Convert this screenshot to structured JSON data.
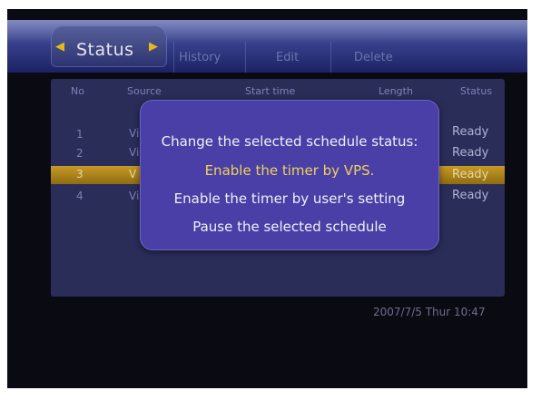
{
  "tabs": {
    "active": "Status",
    "others": [
      "History",
      "Edit",
      "Delete"
    ],
    "arrow_left": "◀",
    "arrow_right": "▶"
  },
  "table": {
    "columns": [
      "No",
      "Source",
      "Start time",
      "Length",
      "Status"
    ],
    "rows": [
      {
        "no": "1",
        "source": "Vi",
        "status": "Ready"
      },
      {
        "no": "2",
        "source": "Vi",
        "status": "Ready"
      },
      {
        "no": "3",
        "source": "V",
        "status": "Ready",
        "selected": true
      },
      {
        "no": "4",
        "source": "Vi",
        "status": "Ready"
      }
    ]
  },
  "dialog": {
    "title": "Change the selected schedule status:",
    "options": [
      {
        "label": "Enable the timer by VPS.",
        "selected": true
      },
      {
        "label": "Enable the timer by user's setting",
        "selected": false
      },
      {
        "label": "Pause the selected schedule",
        "selected": false
      }
    ]
  },
  "clock": "2007/7/5 Thur 10:47",
  "colors": {
    "highlight": "#c79a25",
    "dialog_bg": "#493fa6",
    "selected_text": "#f0d25a",
    "panel_bg": "#2a2d58"
  }
}
